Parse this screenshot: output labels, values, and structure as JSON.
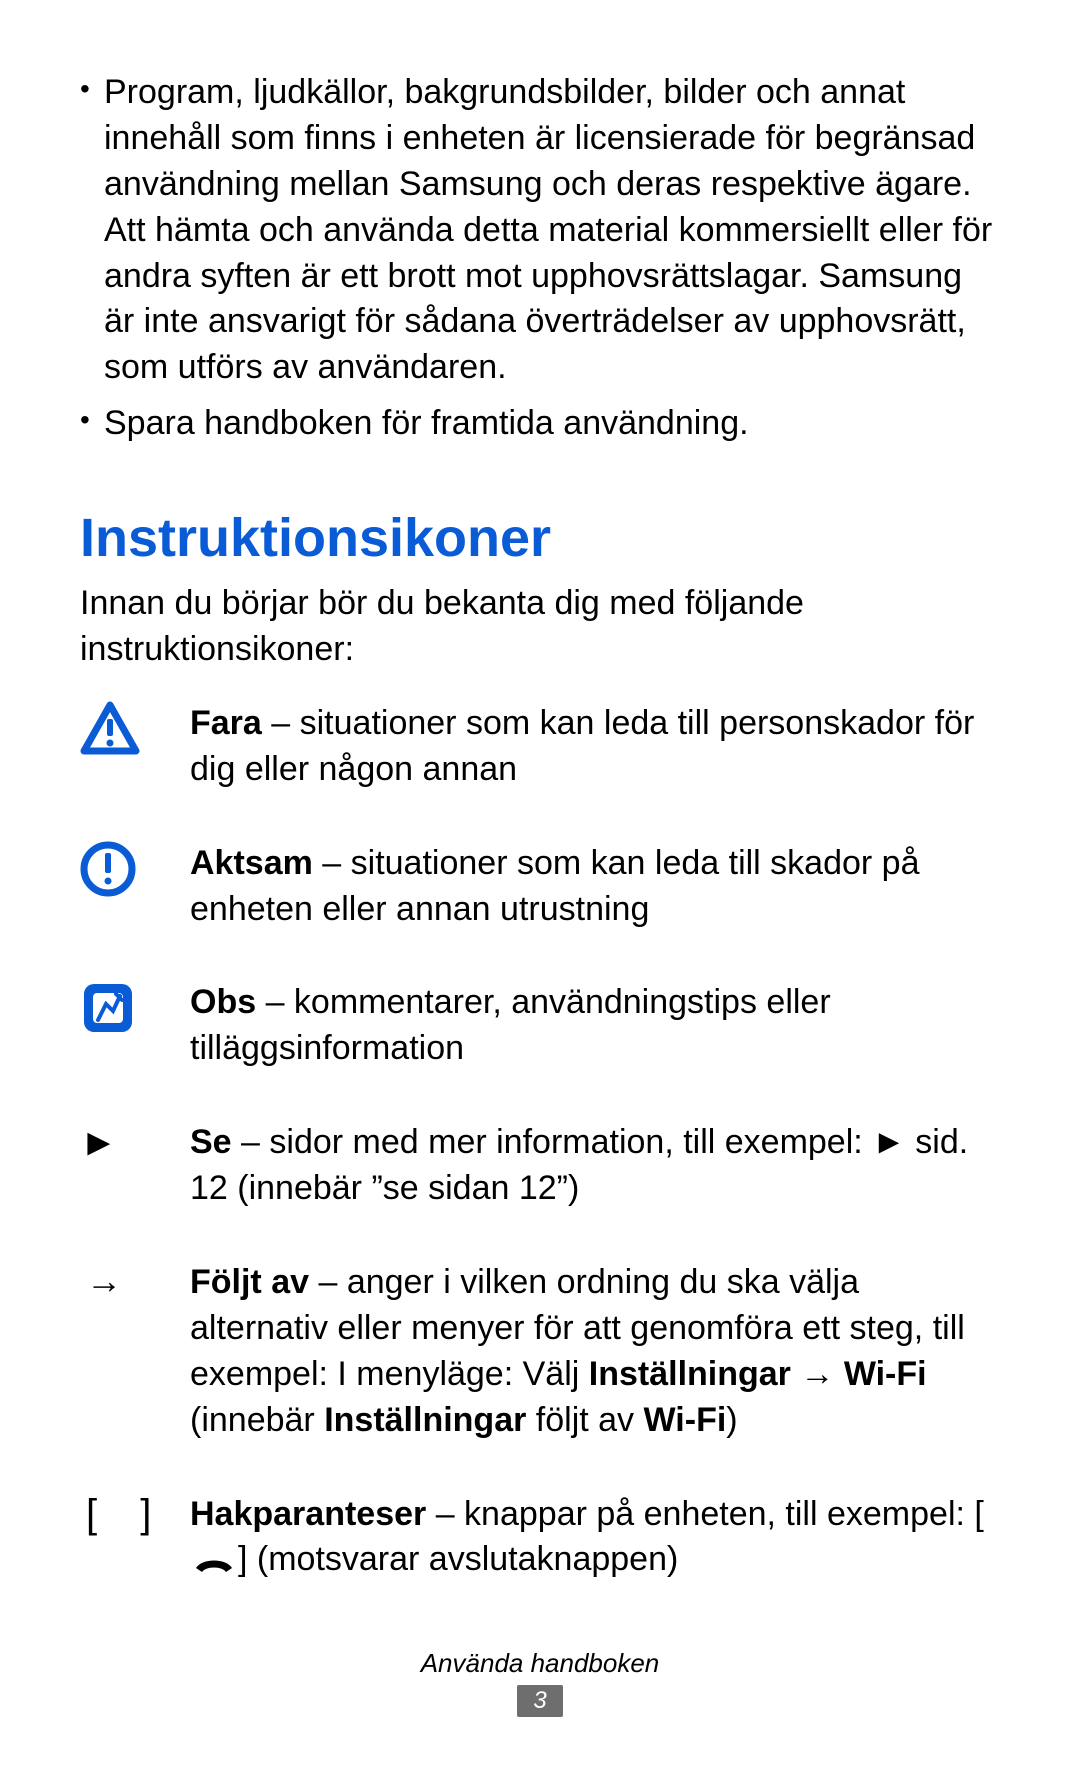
{
  "bullets": [
    "Program, ljudkällor, bakgrundsbilder, bilder och annat innehåll som finns i enheten är licensierade för begränsad användning mellan Samsung och deras respektive ägare. Att hämta och använda detta material kommersiellt eller för andra syften är ett brott mot upphovsrättslagar. Samsung är inte ansvarigt för sådana överträdelser av upphovsrätt, som utförs av användaren.",
    "Spara handboken för framtida användning."
  ],
  "section_title": "Instruktionsikoner",
  "intro": "Innan du börjar bör du bekanta dig med följande instruktionsikoner:",
  "rows": {
    "fara": {
      "bold": "Fara",
      "rest": " – situationer som kan leda till personskador för dig eller någon annan"
    },
    "aktsam": {
      "bold": "Aktsam",
      "rest": " – situationer som kan leda till skador på enheten eller annan utrustning"
    },
    "obs": {
      "bold": "Obs",
      "rest": " – kommentarer, användningstips eller tilläggsinformation"
    },
    "se": {
      "bold": "Se",
      "rest": " – sidor med mer information, till exempel: ► sid. 12 (innebär ”se sidan 12”)"
    },
    "foljt": {
      "bold": "Följt av",
      "rest1": " – anger i vilken ordning du ska välja alternativ eller menyer för att genomföra ett steg, till exempel: I menyläge: Välj ",
      "b2": "Inställningar",
      "arrow": " → ",
      "b3": "Wi-Fi",
      "rest2": " (innebär ",
      "b4": "Inställningar",
      "rest3": " följt av ",
      "b5": "Wi-Fi",
      "rest4": ")"
    },
    "hak": {
      "bold": "Hakparanteser",
      "rest1": " – knappar på enheten, till exempel: [",
      "rest2": "] (motsvarar avslutaknappen)"
    }
  },
  "symbols": {
    "play": "►",
    "arrow": "→",
    "brackets": "[   ]"
  },
  "footer": {
    "title": "Använda handboken",
    "page": "3"
  }
}
